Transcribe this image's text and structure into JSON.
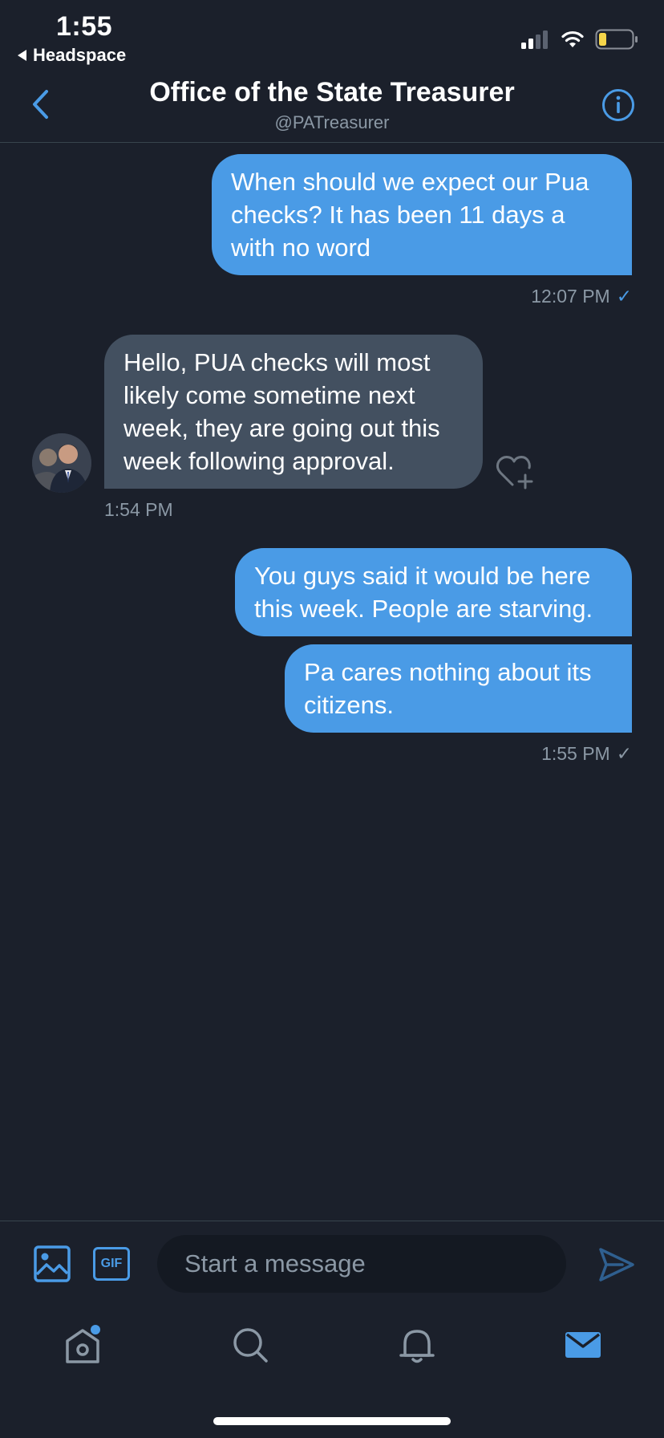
{
  "status_bar": {
    "time": "1:55",
    "back_app": "Headspace"
  },
  "header": {
    "title": "Office of the State Treasurer",
    "handle": "@PATreasurer"
  },
  "messages": [
    {
      "direction": "outgoing",
      "text": "When should we expect our Pua checks? It has been 11 days a with no word",
      "time": "12:07 PM",
      "check": "✓"
    },
    {
      "direction": "incoming",
      "text": "Hello, PUA checks will most likely come sometime next week, they are going out this week following approval.",
      "time": "1:54 PM"
    },
    {
      "direction": "outgoing",
      "text": "You guys said it would be here this week. People are starving."
    },
    {
      "direction": "outgoing",
      "text": "Pa cares nothing about its citizens.",
      "time": "1:55 PM",
      "check": "✓"
    }
  ],
  "composer": {
    "placeholder": "Start a message",
    "gif_label": "GIF"
  },
  "colors": {
    "background": "#1b202b",
    "accent": "#4a9be6",
    "incoming_bubble": "#435060",
    "muted": "#8b98a5"
  },
  "icons": {
    "tabs": [
      "home-icon",
      "search-icon",
      "bell-icon",
      "mail-icon"
    ]
  }
}
